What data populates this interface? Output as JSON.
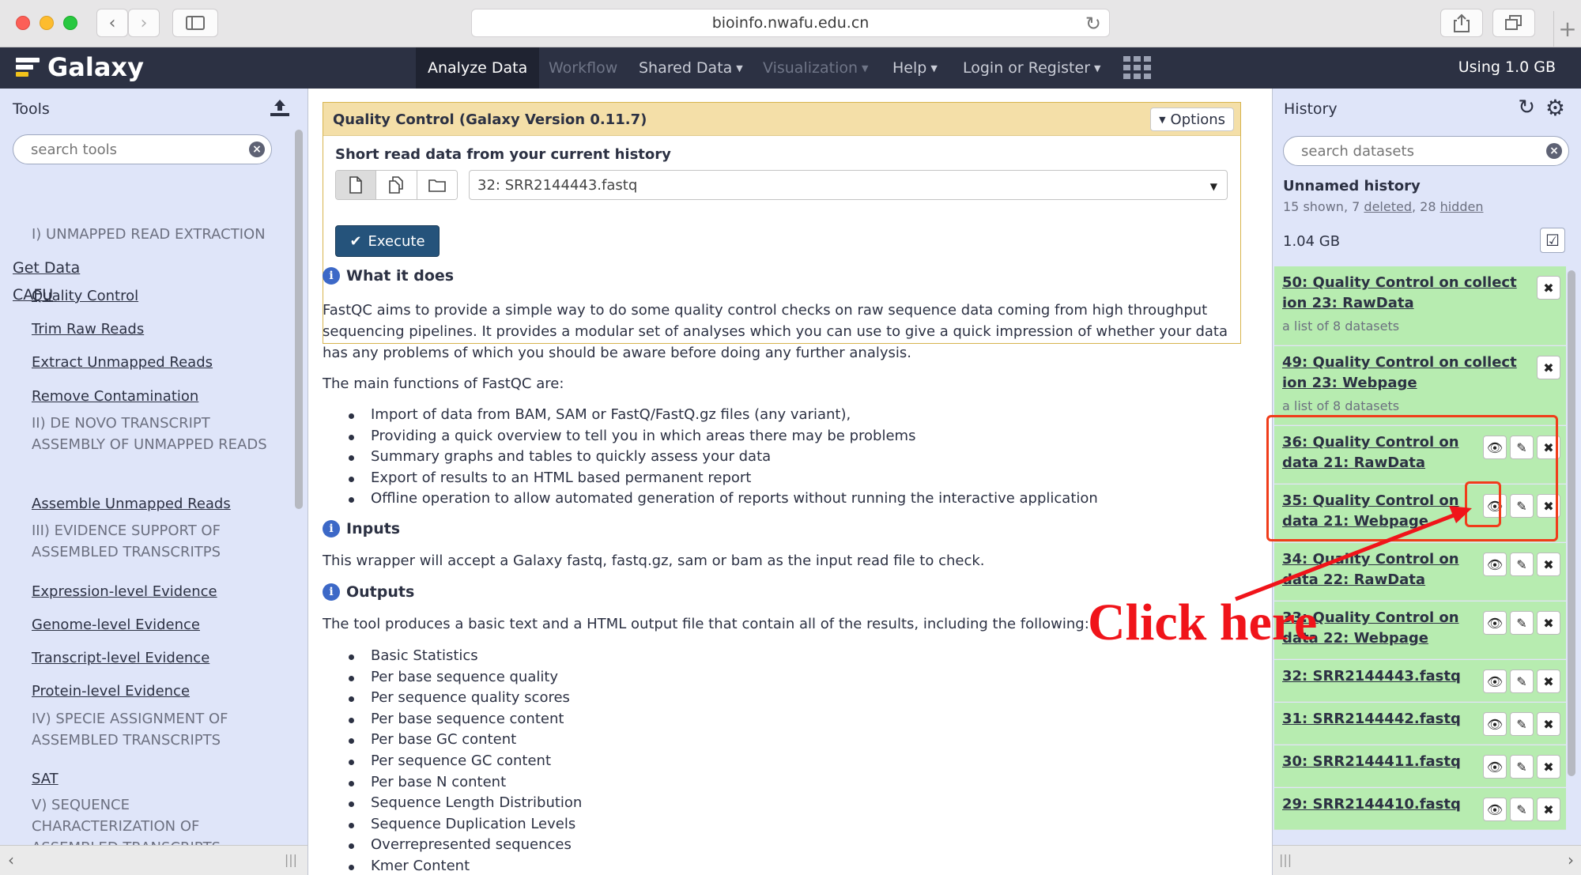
{
  "browser": {
    "url": "bioinfo.nwafu.edu.cn",
    "back_icon": "chevron-left",
    "forward_icon": "chevron-right"
  },
  "masthead": {
    "brand": "Galaxy",
    "nav": [
      {
        "label": "Analyze Data",
        "state": "active",
        "caret": false
      },
      {
        "label": "Workflow",
        "state": "disabled",
        "caret": false
      },
      {
        "label": "Shared Data",
        "state": "normal",
        "caret": true
      },
      {
        "label": "Visualization",
        "state": "disabled",
        "caret": true
      },
      {
        "label": "Help",
        "state": "normal",
        "caret": true
      },
      {
        "label": "Login or Register",
        "state": "normal",
        "caret": true
      }
    ],
    "quota": "Using 1.0 GB"
  },
  "tools_panel": {
    "title": "Tools",
    "search_placeholder": "search tools",
    "sections": [
      "Get Data",
      "CAFU"
    ],
    "items": [
      {
        "type": "label",
        "text": "I) UNMAPPED READ EXTRACTION"
      },
      {
        "type": "link",
        "text": "Quality Control"
      },
      {
        "type": "link",
        "text": "Trim Raw Reads"
      },
      {
        "type": "link",
        "text": "Extract Unmapped Reads"
      },
      {
        "type": "link",
        "text": "Remove Contamination"
      },
      {
        "type": "label",
        "text": "II) DE NOVO TRANSCRIPT ASSEMBLY OF UNMAPPED READS"
      },
      {
        "type": "link",
        "text": "Assemble Unmapped Reads"
      },
      {
        "type": "label",
        "text": "III) EVIDENCE SUPPORT OF ASSEMBLED TRANSCRITPS"
      },
      {
        "type": "link",
        "text": "Expression-level Evidence"
      },
      {
        "type": "link",
        "text": "Genome-level Evidence"
      },
      {
        "type": "link",
        "text": "Transcript-level Evidence"
      },
      {
        "type": "link",
        "text": "Protein-level Evidence"
      },
      {
        "type": "label",
        "text": "IV) SPECIE ASSIGNMENT OF ASSEMBLED TRANSCRIPTS"
      },
      {
        "type": "link",
        "text": "SAT"
      },
      {
        "type": "label",
        "text": "V) SEQUENCE CHARACTERIZATION OF ASSEMBLED TRANSCRIPTS"
      }
    ]
  },
  "tool_form": {
    "title": "Quality Control (Galaxy Version 0.11.7)",
    "options_label": "Options",
    "param_label": "Short read data from your current history",
    "selected_dataset": "32: SRR2144443.fastq",
    "execute_label": "Execute"
  },
  "help": {
    "what_heading": "What it does",
    "what_text": "FastQC aims to provide a simple way to do some quality control checks on raw sequence data coming from high throughput sequencing pipelines. It provides a modular set of analyses which you can use to give a quick impression of whether your data has any problems of which you should be aware before doing any further analysis.",
    "main_functions_intro": "The main functions of FastQC are:",
    "main_functions": [
      "Import of data from BAM, SAM or FastQ/FastQ.gz files (any variant),",
      "Providing a quick overview to tell you in which areas there may be problems",
      "Summary graphs and tables to quickly assess your data",
      "Export of results to an HTML based permanent report",
      "Offline operation to allow automated generation of reports without running the interactive application"
    ],
    "inputs_heading": "Inputs",
    "inputs_text": "This wrapper will accept a Galaxy fastq, fastq.gz, sam or bam as the input read file to check.",
    "outputs_heading": "Outputs",
    "outputs_text": "The tool produces a basic text and a HTML output file that contain all of the results, including the following:",
    "outputs_list": [
      "Basic Statistics",
      "Per base sequence quality",
      "Per sequence quality scores",
      "Per base sequence content",
      "Per base GC content",
      "Per sequence GC content",
      "Per base N content",
      "Sequence Length Distribution",
      "Sequence Duplication Levels",
      "Overrepresented sequences",
      "Kmer Content"
    ]
  },
  "history": {
    "title": "History",
    "search_placeholder": "search datasets",
    "name": "Unnamed history",
    "shown": "15 shown,",
    "deleted_count": "7",
    "deleted_label": "deleted",
    "hidden_count": "28",
    "hidden_label": "hidden",
    "size": "1.04 GB",
    "datasets": [
      {
        "title_l1": "50: Quality Control on collect",
        "title_l2": "ion 23: RawData",
        "sub": "a list of 8 datasets",
        "kind": "collection"
      },
      {
        "title_l1": "49: Quality Control on collect",
        "title_l2": "ion 23: Webpage",
        "sub": "a list of 8 datasets",
        "kind": "collection"
      },
      {
        "title_l1": "36: Quality Control on",
        "title_l2": "data 21: RawData",
        "kind": "dataset"
      },
      {
        "title_l1": "35: Quality Control on",
        "title_l2": "data 21: Webpage",
        "kind": "dataset"
      },
      {
        "title_l1": "34: Quality Control on",
        "title_l2": "data 22: RawData",
        "kind": "dataset"
      },
      {
        "title_l1": "33: Quality Control on",
        "title_l2": "data 22: Webpage",
        "kind": "dataset"
      },
      {
        "title_l1": "32: SRR2144443.fastq",
        "title_l2": "",
        "kind": "dataset"
      },
      {
        "title_l1": "31: SRR2144442.fastq",
        "title_l2": "",
        "kind": "dataset"
      },
      {
        "title_l1": "30: SRR2144411.fastq",
        "title_l2": "",
        "kind": "dataset"
      },
      {
        "title_l1": "29: SRR2144410.fastq",
        "title_l2": "",
        "kind": "dataset"
      }
    ]
  },
  "annotation": {
    "text": "Click here",
    "color": "#f0141a"
  },
  "colors": {
    "masthead": "#2c3143",
    "panel_bg": "#dfe5f9",
    "dataset_ok": "#b7ecb0",
    "form_header": "#f4dfa8",
    "execute": "#25537b"
  }
}
